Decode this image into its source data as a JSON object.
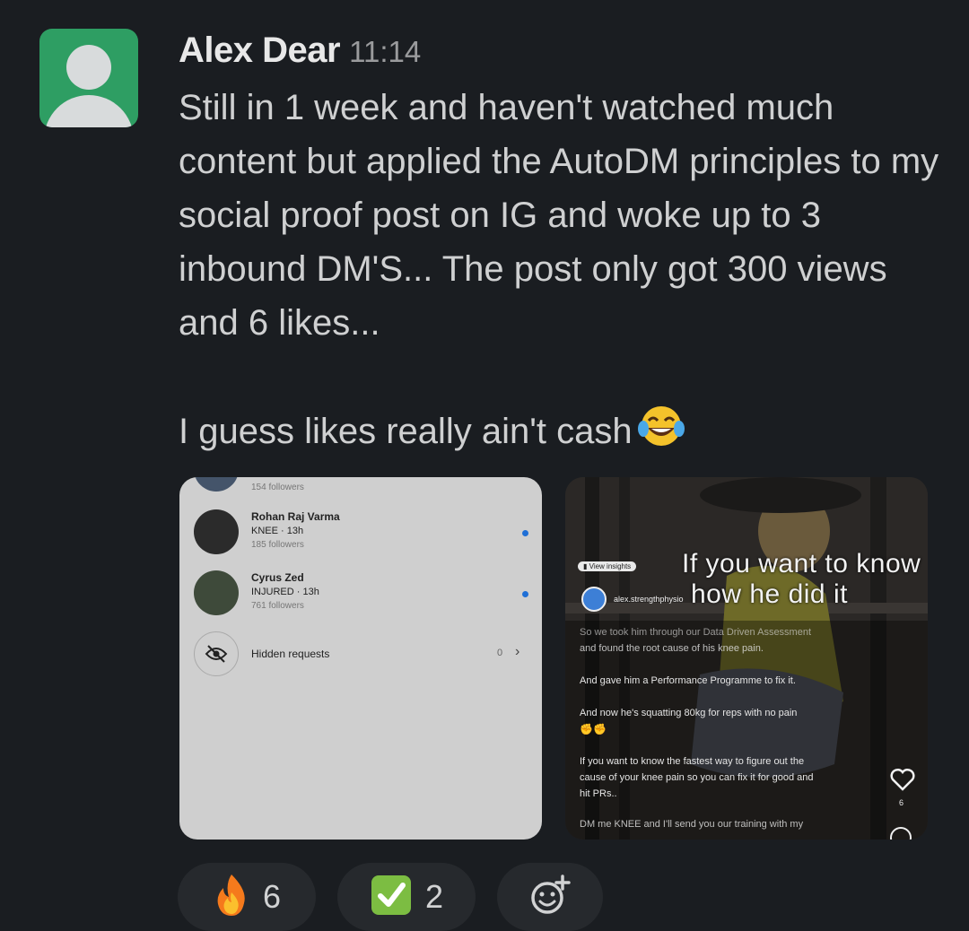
{
  "message": {
    "author": "Alex Dear",
    "time": "11:14",
    "paragraph_1": "Still in 1 week and haven't watched much content but applied the AutoDM principles to my social proof post on IG and woke up to 3 inbound DM'S... The post only got 300 views and 6 likes...",
    "paragraph_2": "I guess likes really ain't cash",
    "paragraph_2_emoji": "face-with-tears-of-joy-emoji"
  },
  "attachment_left": {
    "top_meta": "154 followers",
    "rows": [
      {
        "name": "Rohan Raj Varma",
        "keyword": "KNEE",
        "ago": "13h",
        "followers": "185 followers"
      },
      {
        "name": "Cyrus Zed",
        "keyword": "INJURED",
        "ago": "13h",
        "followers": "761 followers"
      }
    ],
    "hidden_requests_label": "Hidden requests",
    "hidden_requests_count": "0"
  },
  "attachment_right": {
    "overlay_title_line1": "If you want to know",
    "overlay_title_line2": "how he did it",
    "view_insights": "View insights",
    "username": "alex.strengthphysio",
    "caption_lines": [
      "So we took him through our Data Driven Assessment",
      "and found the root cause of his knee pain.",
      "And gave him a Performance Programme to fix it.",
      "And now he's squatting 80kg for reps with no pain",
      "If you want to know the fastest way to figure out the",
      "cause of your knee pain so you can fix it for good and",
      "hit PRs..",
      "DM me KNEE and I'll send you our training with my"
    ],
    "like_count": "6"
  },
  "reactions": [
    {
      "emoji": "fire-emoji",
      "count": "6"
    },
    {
      "emoji": "check-mark-button-emoji",
      "count": "2"
    },
    {
      "emoji": "add-reaction-icon",
      "count": ""
    }
  ],
  "colors": {
    "background": "#1a1d21",
    "avatar": "#2e9e63",
    "text": "#d1d2d3",
    "reaction_pill": "#26292d"
  }
}
